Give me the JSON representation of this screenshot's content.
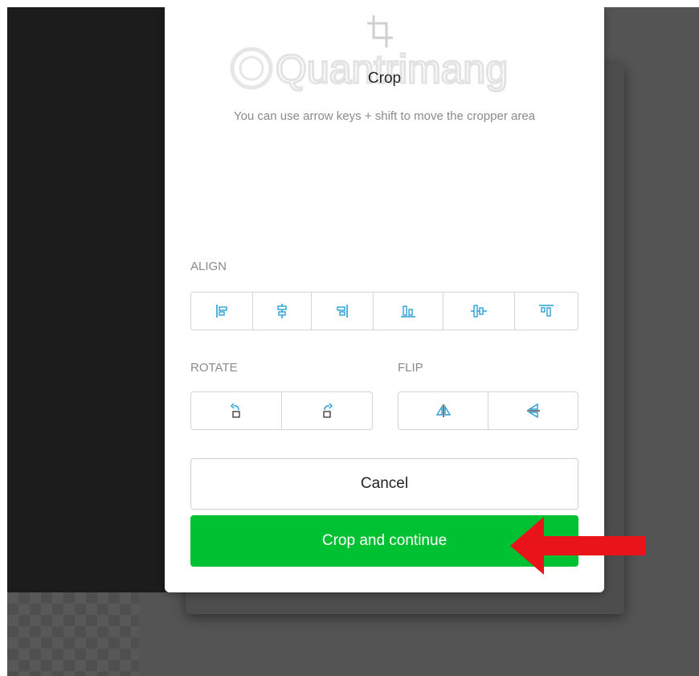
{
  "colors": {
    "accent_green": "#00c132",
    "icon_blue": "#2a9fd6",
    "arrow_red": "#e8141a"
  },
  "watermark": {
    "text": "Quantrimang"
  },
  "modal": {
    "title": "Crop",
    "hint": "You can use arrow keys + shift to move the cropper area",
    "align": {
      "label": "ALIGN",
      "icons": [
        "align-left-icon",
        "align-center-horizontal-icon",
        "align-right-icon",
        "align-bottom-icon",
        "align-center-vertical-icon",
        "align-top-icon"
      ]
    },
    "rotate": {
      "label": "ROTATE",
      "icons": [
        "rotate-left-icon",
        "rotate-right-icon"
      ]
    },
    "flip": {
      "label": "FLIP",
      "icons": [
        "flip-horizontal-icon",
        "flip-vertical-icon"
      ]
    },
    "cancel_label": "Cancel",
    "primary_label": "Crop and continue"
  }
}
